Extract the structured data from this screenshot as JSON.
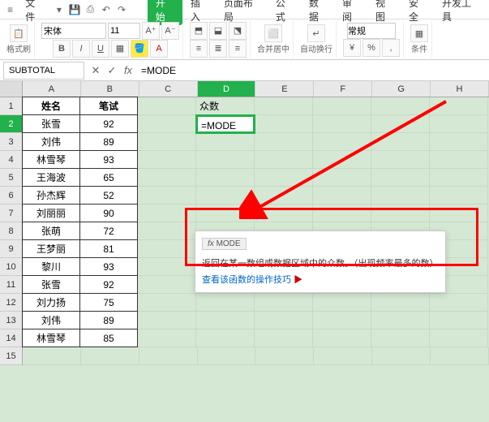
{
  "menubar": {
    "file": "文件",
    "tabs": {
      "start": "开始",
      "insert": "插入",
      "layout": "页面布局",
      "formula": "公式",
      "data": "数据",
      "review": "审阅",
      "view": "视图",
      "security": "安全",
      "dev": "开发工具"
    }
  },
  "toolbar": {
    "paste": "格式刷",
    "font": "宋体",
    "size": "11",
    "merge": "合并居中",
    "wrap": "自动换行",
    "format": "常规",
    "cond": "条件"
  },
  "formula_bar": {
    "name": "SUBTOTAL",
    "formula": "=MODE"
  },
  "columns": [
    "A",
    "B",
    "C",
    "D",
    "E",
    "F",
    "G",
    "H"
  ],
  "headers": {
    "A": "姓名",
    "B": "笔试",
    "D": "众数"
  },
  "table_data": [
    {
      "name": "张雪",
      "score": 92
    },
    {
      "name": "刘伟",
      "score": 89
    },
    {
      "name": "林雪琴",
      "score": 93
    },
    {
      "name": "王海波",
      "score": 65
    },
    {
      "name": "孙杰辉",
      "score": 52
    },
    {
      "name": "刘丽丽",
      "score": 90
    },
    {
      "name": "张萌",
      "score": 72
    },
    {
      "name": "王梦丽",
      "score": 81
    },
    {
      "name": "黎川",
      "score": 93
    },
    {
      "name": "张雪",
      "score": 92
    },
    {
      "name": "刘力扬",
      "score": 75
    },
    {
      "name": "刘伟",
      "score": 89
    },
    {
      "name": "林雪琴",
      "score": 85
    }
  ],
  "editing_cell": "=MODE",
  "tooltip": {
    "fn": "MODE",
    "desc": "返回在某一数组或数据区域中的众数。（出现频率最多的数）",
    "link": "查看该函数的操作技巧"
  }
}
